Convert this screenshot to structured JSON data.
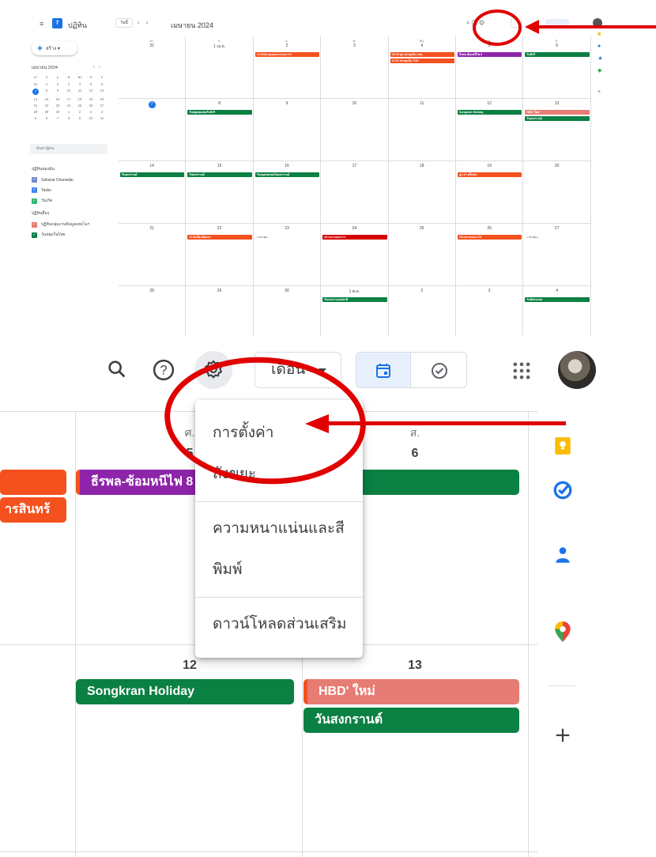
{
  "mini": {
    "app_title": "ปฏิทิน",
    "today_label": "วันนี้",
    "month_title": "เมษายน 2024",
    "create_label": "สร้าง",
    "small_month": "เมษายน 2024",
    "search_people": "ค้นหาผู้คน",
    "my_calendars": "ปฏิทินของฉัน",
    "other_calendars": "ปฏิทินอื่นๆ",
    "my_cal_items": [
      "Saharat Chaowilai",
      "Tasks",
      "วันเกิด"
    ],
    "other_cal_items": [
      "ปฏิทินกลุ่มงานข้อมูลเทคโนฯ",
      "วันหยุดในไทย"
    ],
    "day_headers": [
      "อา.",
      "จ.",
      "อ.",
      "พ.",
      "พฤ.",
      "ศ.",
      "ส."
    ],
    "week_numbers": [
      [
        "31",
        "1 เม.ย.",
        "2",
        "3",
        "4",
        "5",
        "6"
      ],
      [
        "7",
        "8",
        "9",
        "10",
        "11",
        "12",
        "13"
      ],
      [
        "14",
        "15",
        "16",
        "17",
        "18",
        "19",
        "20"
      ],
      [
        "21",
        "22",
        "23",
        "24",
        "25",
        "26",
        "27"
      ],
      [
        "28",
        "29",
        "30",
        "1 พ.ค.",
        "2",
        "3",
        "4"
      ]
    ],
    "events": {
      "e1": "10.00ประชุมคณะกรรมการฯ",
      "e2": "09.00 ทุก ประชุมกับ กสน.",
      "e3": "13.00 ประชุมกับ TOR",
      "e4": "ธีรพล-ซ้อมหนีไฟ 8",
      "e5": "วันจักรี",
      "e6": "วันหยุดชดเชยวันจักรี",
      "e7": "Songkran Holiday",
      "e8": "HBD' ใหม่",
      "e9": "วันสงกรานต์",
      "e10": "วันสงกรานต์",
      "e11": "วันสงกรานต์",
      "e12": "วันหยุดชดเชยวันสงกรานต์",
      "e13": "ลูก สา ครั้งเล่น",
      "e14": "10.00เอ็ด-ติดตาม",
      "e15": "ประชุม...",
      "e16": "ตรวจงานและการ",
      "e17": "เบิก-ตรวจสอบ ITA",
      "e18": "ประชุม...",
      "e19": "วันแรงงานแห่งชาติ",
      "e20": "วันฉัตรมงคล"
    }
  },
  "zoom": {
    "month_select": "เดือน",
    "headers": [
      "ศ.",
      "ส."
    ],
    "day_nums": [
      "5",
      "6",
      "12",
      "13"
    ],
    "menu": [
      "การตั้งค่า",
      "ถังขยะ",
      "ความหนาแน่นและสี",
      "พิมพ์",
      "ดาวน์โหลดส่วนเสริม"
    ],
    "events": {
      "fire_drill": "ธีรพล-ซ้อมหนีไฟ 8",
      "chakri_left": "ารสินทร้",
      "songkran": "Songkran Holiday",
      "hbd": "HBD' ใหม่",
      "songkran_day": "วันสงกรานต์"
    }
  },
  "colors": {
    "green": "#0b8043",
    "orange": "#f4511e",
    "purple": "#8e24aa",
    "salmon": "#e67c73",
    "red_annotation": "#e00000",
    "blue": "#1a73e8"
  }
}
